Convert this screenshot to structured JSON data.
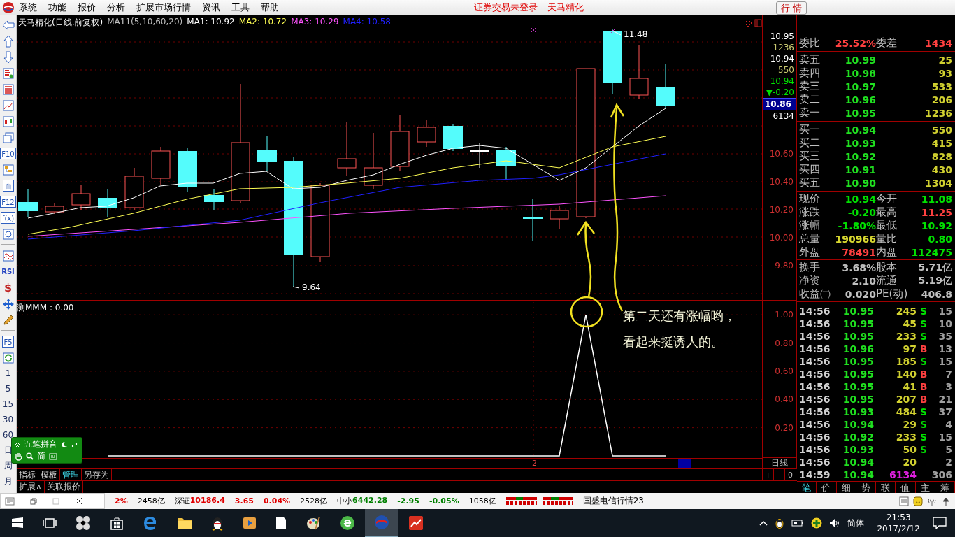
{
  "menu": {
    "items": [
      "系统",
      "功能",
      "报价",
      "分析",
      "扩展市场行情",
      "资讯",
      "工具",
      "帮助"
    ],
    "notice": "证券交易未登录",
    "stock": "天马精化",
    "quote_button": "行 情"
  },
  "toolbar": [
    {
      "kind": "back"
    },
    {
      "kind": "up"
    },
    {
      "kind": "down"
    },
    {
      "kind": "report"
    },
    {
      "kind": "grid"
    },
    {
      "kind": "line"
    },
    {
      "kind": "kline"
    },
    {
      "kind": "windows"
    },
    {
      "kind": "text",
      "label": "F10"
    },
    {
      "kind": "tree"
    },
    {
      "kind": "text",
      "label": "自"
    },
    {
      "kind": "text",
      "label": "F12"
    },
    {
      "kind": "text",
      "label": "f(x)"
    },
    {
      "kind": "circle"
    },
    {
      "kind": "separator"
    },
    {
      "kind": "wave"
    },
    {
      "kind": "rsi",
      "label": "RSI"
    },
    {
      "kind": "dollar",
      "label": "$"
    },
    {
      "kind": "move"
    },
    {
      "kind": "pencil"
    },
    {
      "kind": "separator"
    },
    {
      "kind": "text",
      "label": "F5"
    },
    {
      "kind": "refresh"
    },
    {
      "kind": "period",
      "label": "1"
    },
    {
      "kind": "period",
      "label": "5"
    },
    {
      "kind": "period",
      "label": "15"
    },
    {
      "kind": "period",
      "label": "30"
    },
    {
      "kind": "period",
      "label": "60"
    },
    {
      "kind": "period",
      "label": "日"
    },
    {
      "kind": "period",
      "label": "周"
    },
    {
      "kind": "period",
      "label": "月"
    }
  ],
  "chart": {
    "title": "天马精化(日线.前复权)",
    "formula": "MA11(5,10,60,20)",
    "ma": [
      {
        "label": "MA1: 10.92",
        "color": "#ffffff"
      },
      {
        "label": "MA2: 10.72",
        "color": "#ffff54"
      },
      {
        "label": "MA3: 10.29",
        "color": "#ff54ff"
      },
      {
        "label": "MA4: 10.58",
        "color": "#2020ff"
      }
    ],
    "high_label": "11.48",
    "low_label": "9.64",
    "annotation": [
      "第二天还有涨幅哟，",
      "看起来挺诱人的。"
    ],
    "axis_quote": [
      {
        "text": "10.95",
        "kind": "price",
        "color": "#ffffff"
      },
      {
        "text": "1236",
        "kind": "volume",
        "color": "#c8c870"
      },
      {
        "text": "10.94",
        "kind": "price",
        "color": "#ffffff"
      },
      {
        "text": "550",
        "kind": "volume",
        "color": "#c8c870"
      },
      {
        "text": "10.94",
        "kind": "price",
        "color": "#00e000"
      },
      {
        "text": "▼-0.20",
        "kind": "price",
        "color": "#00e000"
      },
      {
        "text": "10.86",
        "kind": "cursor"
      },
      {
        "text": "6134",
        "kind": "price",
        "color": "#ffffff"
      }
    ],
    "ticks": [
      "10.60",
      "10.40",
      "10.20",
      "10.00",
      "9.80"
    ]
  },
  "indicator": {
    "prefix": "测",
    "value": ": 0.00",
    "chart_data": {
      "type": "line",
      "grid": true,
      "ylim": [
        -0.015,
        1.1
      ],
      "yticks": [
        {
          "value": 0.2,
          "label": "0.20"
        },
        {
          "value": 0.4,
          "label": "0.40"
        },
        {
          "value": 0.6,
          "label": "0.60"
        },
        {
          "value": 0.8,
          "label": "0.80"
        },
        {
          "value": 1.0,
          "label": "1.00"
        }
      ],
      "series": [
        {
          "name": "MMM",
          "color": "#ffffff",
          "values": [
            null,
            null,
            null,
            0,
            0,
            0,
            0,
            0,
            0,
            0,
            0,
            0,
            0,
            0,
            0,
            0,
            0,
            0,
            0,
            0,
            0,
            1,
            0,
            0,
            0,
            null,
            null,
            null
          ]
        }
      ]
    }
  },
  "time_axis": {
    "mark": "2",
    "cursor": "--",
    "period": "日线",
    "zoom": [
      "+",
      "−",
      "0"
    ]
  },
  "bottom_tabs": [
    {
      "label": "指标",
      "selected": false
    },
    {
      "label": "模板",
      "selected": false
    },
    {
      "label": "管理",
      "selected": true
    },
    {
      "label": "另存为",
      "selected": false
    }
  ],
  "bottom_links": [
    "扩展∧",
    "关联报价"
  ],
  "ime": {
    "label": "五笔拼音",
    "mode": "简"
  },
  "quote": {
    "ratio": [
      {
        "label": "委比",
        "value": "25.52%",
        "color": "#ff4040"
      },
      {
        "label": "委差",
        "value": "1434",
        "color": "#ff4040"
      }
    ],
    "asks": [
      {
        "label": "卖五",
        "price": "10.99",
        "volume": "25"
      },
      {
        "label": "卖四",
        "price": "10.98",
        "volume": "93"
      },
      {
        "label": "卖三",
        "price": "10.97",
        "volume": "533"
      },
      {
        "label": "卖二",
        "price": "10.96",
        "volume": "206"
      },
      {
        "label": "卖一",
        "price": "10.95",
        "volume": "1236"
      }
    ],
    "bids": [
      {
        "label": "买一",
        "price": "10.94",
        "volume": "550"
      },
      {
        "label": "买二",
        "price": "10.93",
        "volume": "415"
      },
      {
        "label": "买三",
        "price": "10.92",
        "volume": "828"
      },
      {
        "label": "买四",
        "price": "10.91",
        "volume": "430"
      },
      {
        "label": "买五",
        "price": "10.90",
        "volume": "1304"
      }
    ],
    "stats": [
      {
        "label": "现价",
        "value": "10.94",
        "color": "#00e000"
      },
      {
        "label": "今开",
        "value": "11.08",
        "color": "#00e000"
      },
      {
        "label": "涨跌",
        "value": "-0.20",
        "color": "#00e000"
      },
      {
        "label": "最高",
        "value": "11.25",
        "color": "#ff4040"
      },
      {
        "label": "涨幅",
        "value": "-1.80%",
        "color": "#00e000"
      },
      {
        "label": "最低",
        "value": "10.92",
        "color": "#00e000"
      },
      {
        "label": "总量",
        "value": "190966",
        "color": "#d8d830"
      },
      {
        "label": "量比",
        "value": "0.80",
        "color": "#00e000"
      },
      {
        "label": "外盘",
        "value": "78491",
        "color": "#ff4040"
      },
      {
        "label": "内盘",
        "value": "112475",
        "color": "#00e000"
      }
    ],
    "finance": [
      {
        "label": "换手",
        "value": "3.68%"
      },
      {
        "label": "股本",
        "value": "5.71亿"
      },
      {
        "label": "净资",
        "value": "2.10"
      },
      {
        "label": "流通",
        "value": "5.19亿"
      },
      {
        "label": "收益㈢",
        "value": "0.020"
      },
      {
        "label": "PE(动)",
        "value": "406.8"
      }
    ]
  },
  "trades": [
    {
      "time": "14:56",
      "price": "10.95",
      "volume": "245",
      "side": {
        "text": "S",
        "color": "#00e000"
      },
      "count": "15",
      "big": false
    },
    {
      "time": "14:56",
      "price": "10.95",
      "volume": "45",
      "side": {
        "text": "S",
        "color": "#00e000"
      },
      "count": "10",
      "big": false
    },
    {
      "time": "14:56",
      "price": "10.95",
      "volume": "233",
      "side": {
        "text": "S",
        "color": "#00e000"
      },
      "count": "35",
      "big": false
    },
    {
      "time": "14:56",
      "price": "10.96",
      "volume": "97",
      "side": {
        "text": "B",
        "color": "#ff4040"
      },
      "count": "13",
      "big": false
    },
    {
      "time": "14:56",
      "price": "10.95",
      "volume": "185",
      "side": {
        "text": "S",
        "color": "#00e000"
      },
      "count": "15",
      "big": false
    },
    {
      "time": "14:56",
      "price": "10.95",
      "volume": "140",
      "side": {
        "text": "B",
        "color": "#ff4040"
      },
      "count": "7",
      "big": false
    },
    {
      "time": "14:56",
      "price": "10.95",
      "volume": "41",
      "side": {
        "text": "B",
        "color": "#ff4040"
      },
      "count": "3",
      "big": false
    },
    {
      "time": "14:56",
      "price": "10.95",
      "volume": "207",
      "side": {
        "text": "B",
        "color": "#ff4040"
      },
      "count": "21",
      "big": false
    },
    {
      "time": "14:56",
      "price": "10.93",
      "volume": "484",
      "side": {
        "text": "S",
        "color": "#00e000"
      },
      "count": "37",
      "big": false
    },
    {
      "time": "14:56",
      "price": "10.94",
      "volume": "29",
      "side": {
        "text": "S",
        "color": "#00e000"
      },
      "count": "4",
      "big": false
    },
    {
      "time": "14:56",
      "price": "10.92",
      "volume": "233",
      "side": {
        "text": "S",
        "color": "#00e000"
      },
      "count": "15",
      "big": false
    },
    {
      "time": "14:56",
      "price": "10.93",
      "volume": "50",
      "side": {
        "text": "S",
        "color": "#00e000"
      },
      "count": "5",
      "big": false
    },
    {
      "time": "14:56",
      "price": "10.94",
      "volume": "20",
      "count": "2",
      "big": false
    },
    {
      "time": "14:59",
      "price": "10.94",
      "volume": "6134",
      "count": "306",
      "big": true
    }
  ],
  "panel_tabs": [
    {
      "label": "笔",
      "selected": true
    },
    {
      "label": "价",
      "selected": false
    },
    {
      "label": "细",
      "selected": false
    },
    {
      "label": "势",
      "selected": false
    },
    {
      "label": "联",
      "selected": false
    },
    {
      "label": "值",
      "selected": false
    },
    {
      "label": "主",
      "selected": false
    },
    {
      "label": "筹",
      "selected": false
    }
  ],
  "status_bar": {
    "partial": {
      "percent": "2%",
      "amount": "2458亿",
      "color": "#e00000"
    },
    "indices": [
      {
        "name": "深证",
        "value": "10186.4",
        "change": "3.65",
        "percent": "0.04%",
        "amount": "2528亿",
        "color": "#e00000"
      },
      {
        "name": "中小",
        "value": "6442.28",
        "change": "-2.95",
        "percent": "-0.05%",
        "amount": "1058亿",
        "color": "#008000"
      }
    ],
    "ticker": "国盛电信行情23"
  },
  "taskbar": {
    "language": "简体",
    "time": "21:53",
    "date": "2017/2/12"
  }
}
